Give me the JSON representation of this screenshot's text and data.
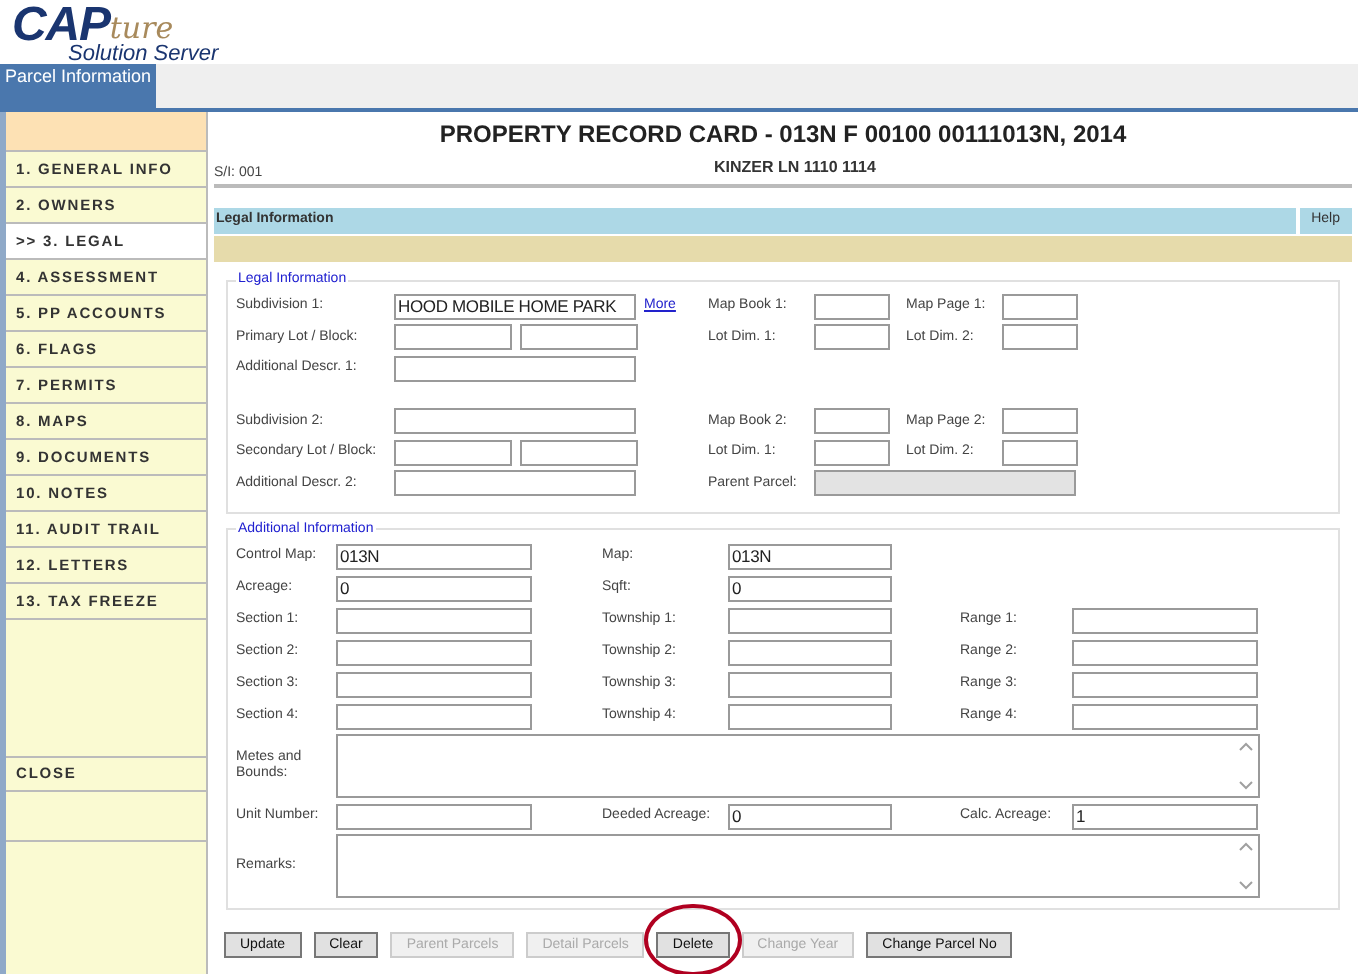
{
  "logo": {
    "main": "CAP",
    "script": "ture",
    "subtitle": "Solution Server"
  },
  "top_tab": {
    "label": "Parcel Information",
    "selected": true
  },
  "sidebar": {
    "items": [
      {
        "label": "1. GENERAL INFO",
        "selected": false
      },
      {
        "label": "2. OWNERS",
        "selected": false
      },
      {
        "label": ">> 3. LEGAL",
        "selected": true
      },
      {
        "label": "4. ASSESSMENT",
        "selected": false
      },
      {
        "label": "5. PP ACCOUNTS",
        "selected": false
      },
      {
        "label": "6. FLAGS",
        "selected": false
      },
      {
        "label": "7. PERMITS",
        "selected": false
      },
      {
        "label": "8. MAPS",
        "selected": false
      },
      {
        "label": "9. DOCUMENTS",
        "selected": false
      },
      {
        "label": "10. NOTES",
        "selected": false
      },
      {
        "label": "11. AUDIT TRAIL",
        "selected": false
      },
      {
        "label": "12. LETTERS",
        "selected": false
      },
      {
        "label": "13. TAX FREEZE",
        "selected": false
      }
    ],
    "close": "CLOSE"
  },
  "header": {
    "title": "PROPERTY RECORD CARD - 013N F 00100 00111013N, 2014",
    "si": "S/I: 001",
    "address": "KINZER LN 1110 1114"
  },
  "section_bar": {
    "title": "Legal Information",
    "help": "Help"
  },
  "legal": {
    "legend": "Legal Information",
    "rows": [
      {
        "label": "Subdivision 1:",
        "split": false,
        "value": "HOOD MOBILE HOME PARK",
        "link": "More",
        "right": [
          {
            "label": "Map Book 1:",
            "disabled": false
          },
          {
            "label": "Map Page 1:",
            "disabled": false
          }
        ]
      },
      {
        "label": "Primary Lot / Block:",
        "split": true,
        "right": [
          {
            "label": "Lot Dim. 1:",
            "disabled": false
          },
          {
            "label": "Lot Dim. 2:",
            "disabled": false
          }
        ]
      },
      {
        "label": "Additional Descr. 1:",
        "split": false
      },
      {
        "kind": "spacer"
      },
      {
        "label": "Subdivision 2:",
        "split": false,
        "right": [
          {
            "label": "Map Book 2:",
            "disabled": false
          },
          {
            "label": "Map Page 2:",
            "disabled": false
          }
        ]
      },
      {
        "label": "Secondary Lot / Block:",
        "split": true,
        "right": [
          {
            "label": "Lot Dim. 1:",
            "disabled": false
          },
          {
            "label": "Lot Dim. 2:",
            "disabled": false
          }
        ]
      },
      {
        "label": "Additional Descr. 2:",
        "split": false,
        "right": [
          {
            "label": "Parent Parcel:",
            "disabled": true
          }
        ]
      }
    ]
  },
  "additional": {
    "legend": "Additional Information",
    "rows": [
      {
        "kind": "fields",
        "cells": [
          {
            "label": "Control Map:",
            "value": "013N"
          },
          {
            "label": "Map:",
            "value": "013N"
          }
        ]
      },
      {
        "kind": "fields",
        "cells": [
          {
            "label": "Acreage:",
            "value": "0"
          },
          {
            "label": "Sqft:",
            "value": "0"
          }
        ]
      },
      {
        "kind": "fields",
        "cells": [
          {
            "label": "Section 1:"
          },
          {
            "label": "Township 1:"
          },
          {
            "label": "Range 1:"
          }
        ]
      },
      {
        "kind": "fields",
        "cells": [
          {
            "label": "Section 2:"
          },
          {
            "label": "Township 2:"
          },
          {
            "label": "Range 2:"
          }
        ]
      },
      {
        "kind": "fields",
        "cells": [
          {
            "label": "Section 3:"
          },
          {
            "label": "Township 3:"
          },
          {
            "label": "Range 3:"
          }
        ]
      },
      {
        "kind": "fields",
        "cells": [
          {
            "label": "Section 4:"
          },
          {
            "label": "Township 4:"
          },
          {
            "label": "Range 4:"
          }
        ]
      },
      {
        "kind": "textarea",
        "label": "Metes and Bounds:"
      },
      {
        "kind": "fields",
        "cells": [
          {
            "label": "Unit Number:"
          },
          {
            "label": "Deeded Acreage:",
            "value": "0"
          },
          {
            "label": "Calc. Acreage:",
            "value": "1"
          }
        ]
      },
      {
        "kind": "textarea",
        "label": "Remarks:"
      }
    ]
  },
  "buttons": [
    {
      "label": "Update",
      "disabled": false,
      "highlighted": false
    },
    {
      "label": "Clear",
      "disabled": false,
      "highlighted": false
    },
    {
      "label": "Parent Parcels",
      "disabled": true,
      "highlighted": false
    },
    {
      "label": "Detail Parcels",
      "disabled": true,
      "highlighted": false
    },
    {
      "label": "Delete",
      "disabled": false,
      "highlighted": true
    },
    {
      "label": "Change Year",
      "disabled": true,
      "highlighted": false
    },
    {
      "label": "Change Parcel No",
      "disabled": false,
      "highlighted": false
    }
  ]
}
